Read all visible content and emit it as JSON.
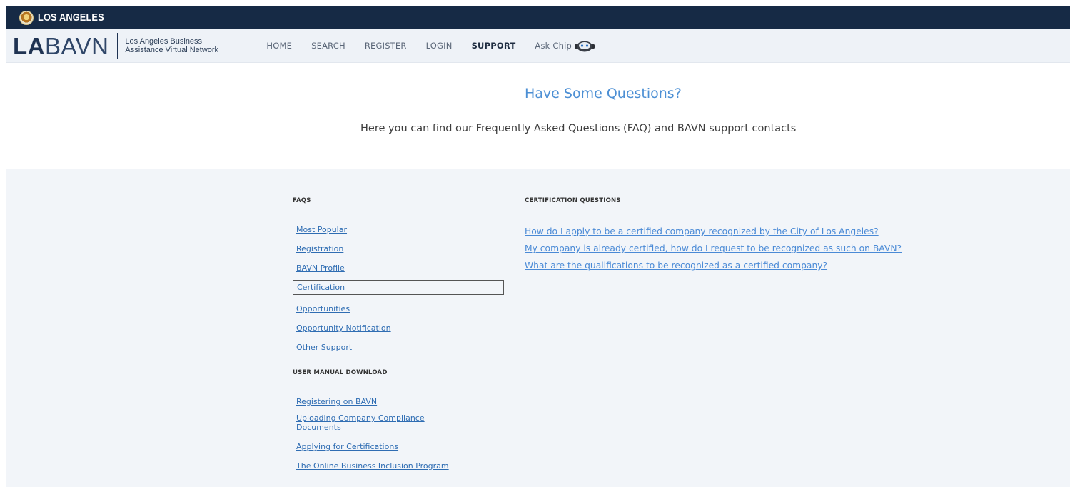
{
  "city_bar": {
    "title": "LOS ANGELES"
  },
  "header": {
    "logo_bold": "LA",
    "logo_light": "BAVN",
    "tagline_line1": "Los Angeles Business",
    "tagline_line2": "Assistance Virtual Network"
  },
  "nav": {
    "items": [
      {
        "label": "HOME",
        "active": false
      },
      {
        "label": "SEARCH",
        "active": false
      },
      {
        "label": "REGISTER",
        "active": false
      },
      {
        "label": "LOGIN",
        "active": false
      },
      {
        "label": "SUPPORT",
        "active": true
      }
    ],
    "ask_chip": "Ask Chip"
  },
  "hero": {
    "title": "Have Some Questions?",
    "subtitle": "Here you can find our Frequently Asked Questions (FAQ) and BAVN support contacts"
  },
  "faqs": {
    "heading": "FAQS",
    "items": [
      "Most Popular",
      "Registration",
      "BAVN Profile",
      "Certification",
      "Opportunities",
      "Opportunity Notification",
      "Other Support"
    ],
    "selected": "Certification"
  },
  "manual": {
    "heading": "USER MANUAL DOWNLOAD",
    "items": [
      "Registering on BAVN",
      "Uploading Company Compliance Documents",
      "Applying for Certifications",
      "The Online Business Inclusion Program"
    ]
  },
  "questions": {
    "heading": "CERTIFICATION QUESTIONS",
    "items": [
      "How do I apply to be a certified company recognized by the City of Los Angeles?",
      "My company is already certified, how do I request to be recognized as such on BAVN?",
      "What are the qualifications to be recognized as a certified company?"
    ]
  },
  "colors": {
    "city_bar": "#162a45",
    "nav_bg": "#eef2f7",
    "accent_title": "#4c8fd4",
    "link": "#2f6db3",
    "content_bg": "#f2f5f9"
  }
}
